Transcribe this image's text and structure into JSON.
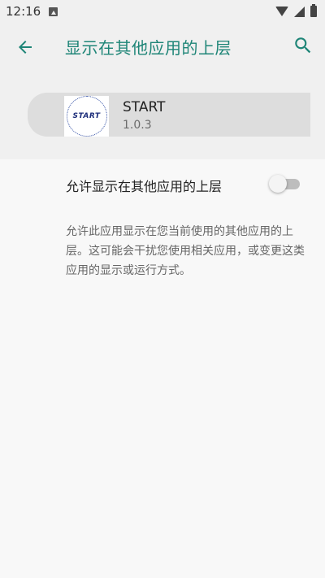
{
  "status_bar": {
    "time": "12:16"
  },
  "toolbar": {
    "title": "显示在其他应用的上层",
    "back_icon": "arrow-back-icon",
    "search_icon": "search-icon"
  },
  "app": {
    "name": "START",
    "version": "1.0.3",
    "icon_text": "START"
  },
  "permission": {
    "label": "允许显示在其他应用的上层",
    "enabled": false,
    "description": "允许此应用显示在您当前使用的其他应用的上层。这可能会干扰您使用相关应用，或变更这类应用的显示或运行方式。"
  },
  "colors": {
    "accent": "#1e8577",
    "header_bg": "#f0f0f0",
    "content_bg": "#f8f8f8"
  }
}
